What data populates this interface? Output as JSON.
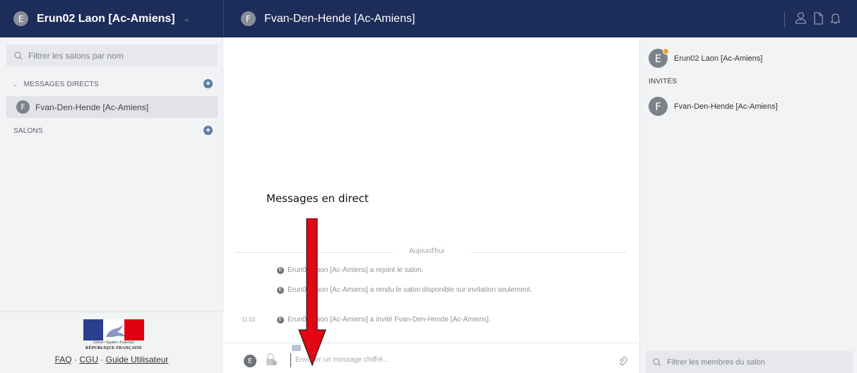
{
  "topbar": {
    "room_switch": {
      "avatar_letter": "E",
      "name": "Erun02 Laon [Ac-Amiens]"
    },
    "room_title": {
      "avatar_letter": "F",
      "name": "Fvan-Den-Hende [Ac-Amiens]"
    },
    "icons": [
      "user-icon",
      "file-icon",
      "bell-icon"
    ]
  },
  "sidebar": {
    "filter_placeholder": "Filtrer les salons par nom",
    "direct_messages_header": "MESSAGES DIRECTS",
    "direct_messages": [
      {
        "avatar_letter": "F",
        "label": "Fvan-Den-Hende [Ac-Amiens]"
      }
    ],
    "salons_header": "SALONS",
    "footer": {
      "motto": "Liberté • Égalité • Fraternité",
      "republique": "RÉPUBLIQUE FRANÇAISE",
      "links": [
        "FAQ",
        "CGU",
        "Guide Utilisateur"
      ],
      "separator": " · "
    }
  },
  "chat": {
    "annotation": "Messages en direct",
    "day_label": "Aujourd'hui",
    "events": [
      {
        "avatar_letter": "E",
        "text": "Erun02 Laon [Ac-Amiens] a rejoint le salon."
      },
      {
        "avatar_letter": "E",
        "text": "Erun02 Laon [Ac-Amiens] a rendu le salon disponible sur invitation seulement."
      },
      {
        "avatar_letter": "E",
        "text": "Erun02 Laon [Ac-Amiens] a invité Fvan-Den-Hende [Ac-Amiens].",
        "timestamp": "11:02"
      }
    ],
    "composer": {
      "avatar_letter": "E",
      "placeholder": "Envoyer un message chiffré…"
    }
  },
  "right_panel": {
    "members": [
      {
        "avatar_letter": "E",
        "label": "Erun02 Laon [Ac-Amiens]"
      }
    ],
    "invites_header": "INVITÉS",
    "invited": [
      {
        "avatar_letter": "F",
        "label": "Fvan-Den-Hende [Ac-Amiens]"
      }
    ],
    "filter_placeholder": "Filtrer les membres du salon"
  },
  "colors": {
    "topbar": "#1d2d5a",
    "sidebar_bg": "#f2f3f5",
    "accent_plus": "#5c7ba6",
    "annotation_arrow": "#e30613"
  }
}
